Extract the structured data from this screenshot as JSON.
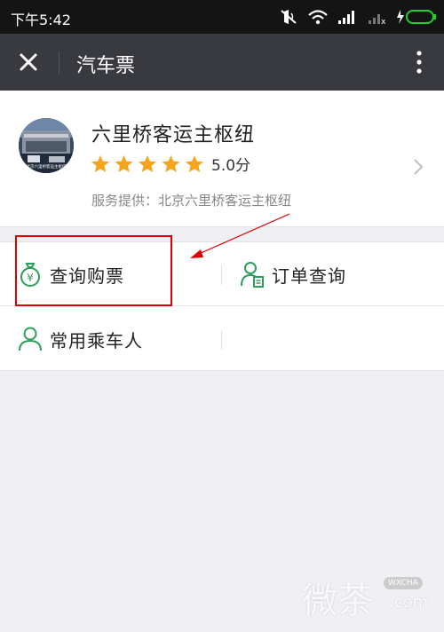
{
  "status_bar": {
    "time": "下午5:42"
  },
  "title_bar": {
    "title": "汽车票",
    "close_icon": "close-icon",
    "more_icon": "more-vertical-icon"
  },
  "merchant": {
    "name": "六里桥客运主枢纽",
    "rating": 5.0,
    "rating_text": "5.0分",
    "stars_filled": 5,
    "provider_text": "服务提供：北京六里桥客运主枢纽",
    "avatar_text": "北京六里桥客运主枢纽",
    "star_color": "#f7a41d"
  },
  "menu": {
    "items": [
      {
        "label": "查询购票",
        "icon": "money-bag-icon"
      },
      {
        "label": "订单查询",
        "icon": "user-document-icon"
      },
      {
        "label": "常用乘车人",
        "icon": "user-icon"
      }
    ],
    "accent_color": "#2aa05b"
  },
  "watermark": {
    "main": "微茶",
    "badge": "WXCHA",
    "domain": ".com"
  }
}
